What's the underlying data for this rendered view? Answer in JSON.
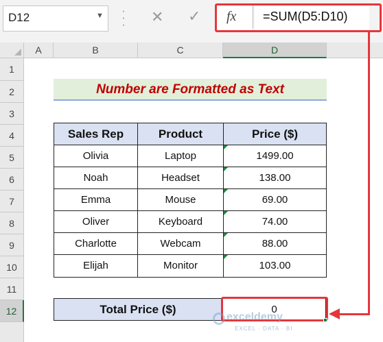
{
  "formula_bar": {
    "name_box": "D12",
    "fx_label": "fx",
    "formula": "=SUM(D5:D10)",
    "cancel_icon": "✕",
    "enter_icon": "✓"
  },
  "columns": [
    "A",
    "B",
    "C",
    "D"
  ],
  "selected_column": "D",
  "rows": [
    "1",
    "2",
    "3",
    "4",
    "5",
    "6",
    "7",
    "8",
    "9",
    "10",
    "11",
    "12"
  ],
  "selected_row": "12",
  "banner": {
    "text": "Number are Formatted as Text"
  },
  "table": {
    "headers": [
      "Sales Rep",
      "Product",
      "Price ($)"
    ],
    "rows": [
      [
        "Olivia",
        "Laptop",
        "1499.00"
      ],
      [
        "Noah",
        "Headset",
        "138.00"
      ],
      [
        "Emma",
        "Mouse",
        "69.00"
      ],
      [
        "Oliver",
        "Keyboard",
        "74.00"
      ],
      [
        "Charlotte",
        "Webcam",
        "88.00"
      ],
      [
        "Elijah",
        "Monitor",
        "103.00"
      ]
    ]
  },
  "total": {
    "label": "Total Price ($)",
    "value": "0"
  },
  "watermark": {
    "brand": "exceldemy",
    "tagline": "EXCEL · DATA · BI"
  },
  "colors": {
    "accent_red": "#e4363b",
    "excel_green": "#217346",
    "header_blue": "#d9e1f2",
    "banner_green": "#e2efda",
    "banner_text": "#c00000"
  },
  "icons": [
    "dropdown-arrow-icon",
    "cancel-icon",
    "enter-check-icon",
    "fx-icon",
    "text-number-error-icon"
  ]
}
